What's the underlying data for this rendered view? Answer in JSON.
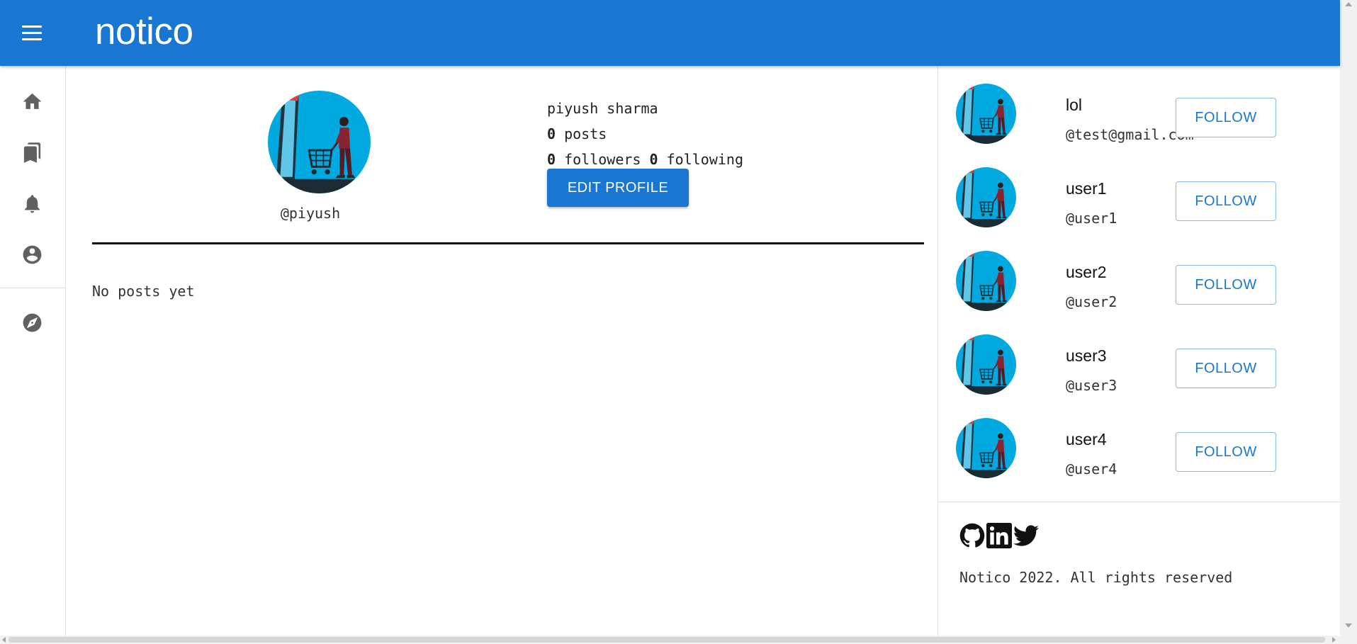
{
  "app": {
    "brand": "notico"
  },
  "colors": {
    "primary": "#1976d2",
    "avatar_bg": "#00a9e0"
  },
  "sidebar": {
    "items": [
      {
        "icon": "home-icon",
        "label": "Home"
      },
      {
        "icon": "bookmarks-icon",
        "label": "Bookmarks"
      },
      {
        "icon": "bell-icon",
        "label": "Notifications"
      },
      {
        "icon": "account-icon",
        "label": "Profile"
      },
      {
        "icon": "compass-icon",
        "label": "Explore"
      }
    ]
  },
  "profile": {
    "name": "piyush sharma",
    "handle": "@piyush",
    "posts_count": "0",
    "posts_label": "posts",
    "followers_count": "0",
    "followers_label": "followers",
    "following_count": "0",
    "following_label": "following",
    "edit_label": "EDIT PROFILE",
    "empty_text": "No posts yet"
  },
  "suggestions": [
    {
      "name": "lol",
      "handle": "@test@gmail.com",
      "button": "FOLLOW"
    },
    {
      "name": "user1",
      "handle": "@user1",
      "button": "FOLLOW"
    },
    {
      "name": "user2",
      "handle": "@user2",
      "button": "FOLLOW"
    },
    {
      "name": "user3",
      "handle": "@user3",
      "button": "FOLLOW"
    },
    {
      "name": "user4",
      "handle": "@user4",
      "button": "FOLLOW"
    }
  ],
  "footer": {
    "socials": [
      "github-icon",
      "linkedin-icon",
      "twitter-icon"
    ],
    "copyright": "Notico 2022. All rights reserved"
  }
}
